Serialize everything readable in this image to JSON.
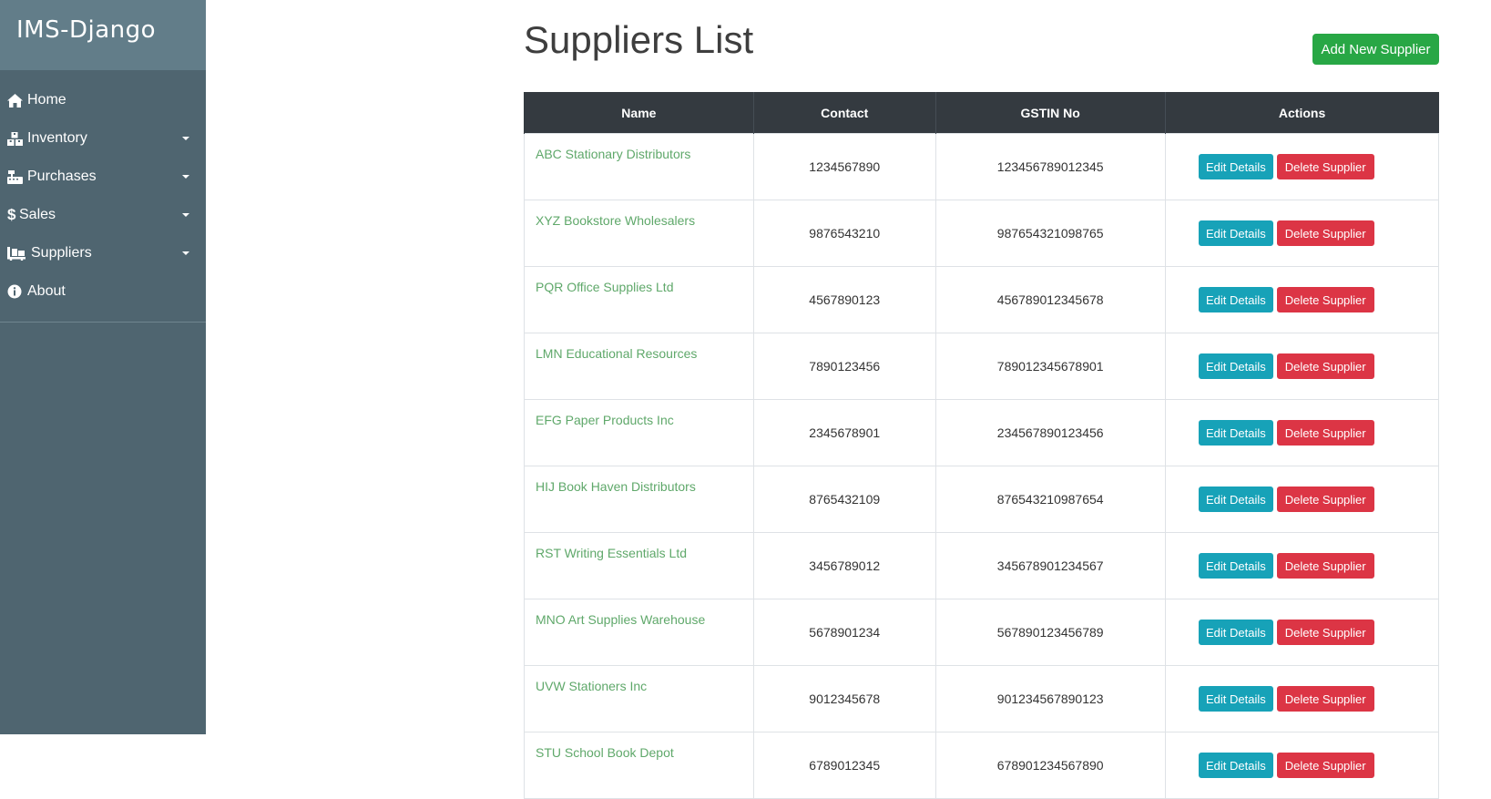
{
  "app": {
    "brand": "IMS-Django"
  },
  "sidebar": {
    "items": [
      {
        "label": "Home",
        "icon": "home-icon",
        "has_caret": false
      },
      {
        "label": "Inventory",
        "icon": "boxes-icon",
        "has_caret": true
      },
      {
        "label": "Purchases",
        "icon": "cash-register-icon",
        "has_caret": true
      },
      {
        "label": "Sales",
        "icon": "dollar-icon",
        "has_caret": true
      },
      {
        "label": "Suppliers",
        "icon": "dolly-icon",
        "has_caret": true
      },
      {
        "label": "About",
        "icon": "info-circle-icon",
        "has_caret": false
      }
    ]
  },
  "page": {
    "title": "Suppliers List",
    "add_button_label": "Add New Supplier"
  },
  "table": {
    "headers": [
      "Name",
      "Contact",
      "GSTIN No",
      "Actions"
    ],
    "edit_label": "Edit Details",
    "delete_label": "Delete Supplier",
    "rows": [
      {
        "name": "ABC Stationary Distributors",
        "contact": "1234567890",
        "gstin": "123456789012345"
      },
      {
        "name": "XYZ Bookstore Wholesalers",
        "contact": "9876543210",
        "gstin": "987654321098765"
      },
      {
        "name": "PQR Office Supplies Ltd",
        "contact": "4567890123",
        "gstin": "456789012345678"
      },
      {
        "name": "LMN Educational Resources",
        "contact": "7890123456",
        "gstin": "789012345678901"
      },
      {
        "name": "EFG Paper Products Inc",
        "contact": "2345678901",
        "gstin": "234567890123456"
      },
      {
        "name": "HIJ Book Haven Distributors",
        "contact": "8765432109",
        "gstin": "876543210987654"
      },
      {
        "name": "RST Writing Essentials Ltd",
        "contact": "3456789012",
        "gstin": "345678901234567"
      },
      {
        "name": "MNO Art Supplies Warehouse",
        "contact": "5678901234",
        "gstin": "567890123456789"
      },
      {
        "name": "UVW Stationers Inc",
        "contact": "9012345678",
        "gstin": "901234567890123"
      },
      {
        "name": "STU School Book Depot",
        "contact": "6789012345",
        "gstin": "678901234567890"
      }
    ]
  },
  "colors": {
    "sidebar_bg": "#4f6570",
    "brand_bg": "#627d89",
    "table_header_bg": "#343a40",
    "link": "#5fa86a",
    "add_button": "#28a745",
    "edit_button": "#17a2b8",
    "delete_button": "#dc3545"
  }
}
